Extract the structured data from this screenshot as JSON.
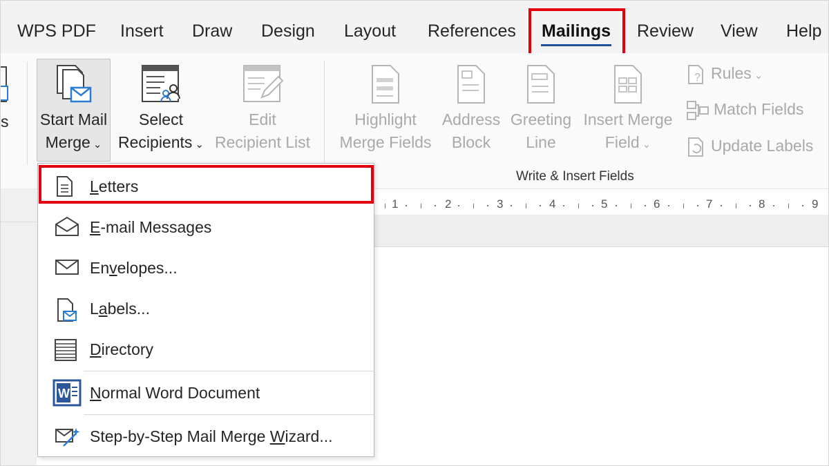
{
  "tabs": [
    {
      "label": "WPS PDF",
      "active": false
    },
    {
      "label": "Insert",
      "active": false
    },
    {
      "label": "Draw",
      "active": false
    },
    {
      "label": "Design",
      "active": false
    },
    {
      "label": "Layout",
      "active": false
    },
    {
      "label": "References",
      "active": false
    },
    {
      "label": "Mailings",
      "active": true
    },
    {
      "label": "Review",
      "active": false
    },
    {
      "label": "View",
      "active": false
    },
    {
      "label": "Help",
      "active": false
    }
  ],
  "ribbon": {
    "left_cut_text": "s",
    "start_mail_merge": {
      "line1": "Start Mail",
      "line2": "Merge",
      "icon": "start-mail-merge-icon"
    },
    "select_recipients": {
      "line1": "Select",
      "line2": "Recipients",
      "icon": "select-recipients-icon"
    },
    "edit_recipient_list": {
      "line1": "Edit",
      "line2": "Recipient List",
      "icon": "edit-recipient-list-icon",
      "disabled": true
    },
    "highlight_merge_fields": {
      "line1": "Highlight",
      "line2": "Merge Fields",
      "disabled": true
    },
    "address_block": {
      "line1": "Address",
      "line2": "Block",
      "disabled": true
    },
    "greeting_line": {
      "line1": "Greeting",
      "line2": "Line",
      "disabled": true
    },
    "insert_merge_field": {
      "line1": "Insert Merge",
      "line2": "Field",
      "disabled": true
    },
    "rules": "Rules",
    "match_fields": "Match Fields",
    "update_labels": "Update Labels",
    "group_label": "Write & Insert Fields"
  },
  "ruler": {
    "ticks": [
      "1",
      "2",
      "3",
      "4",
      "5",
      "6",
      "7",
      "8",
      "9"
    ]
  },
  "start_merge_menu": {
    "items": [
      {
        "label": "Letters",
        "mnemonic": "L",
        "icon": "letter-document-icon",
        "highlighted": true
      },
      {
        "label": "E-mail Messages",
        "mnemonic": "E",
        "icon": "email-envelope-icon"
      },
      {
        "label": "Envelopes...",
        "mnemonic": "v",
        "icon": "envelope-icon"
      },
      {
        "label": "Labels...",
        "mnemonic": "a",
        "icon": "labels-icon"
      },
      {
        "label": "Directory",
        "mnemonic": "D",
        "icon": "directory-icon"
      },
      {
        "label": "Normal Word Document",
        "mnemonic": "N",
        "icon": "word-document-icon"
      },
      {
        "label": "Step-by-Step Mail Merge Wizard...",
        "mnemonic": "W",
        "icon": "wizard-icon"
      }
    ]
  },
  "colors": {
    "highlight_box": "#e3000f",
    "active_tab_underline": "#1f4e9a",
    "accent_blue": "#2b7cd3",
    "disabled_text": "#a9a9a9"
  }
}
